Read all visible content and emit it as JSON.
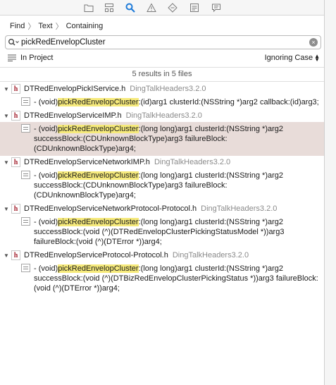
{
  "toolbar": {
    "icons": [
      "folder-icon",
      "hierarchy-icon",
      "search-icon",
      "warning-icon",
      "diamond-icon",
      "list-icon",
      "comment-icon"
    ]
  },
  "find_bar": {
    "mode": "Find",
    "kind": "Text",
    "match": "Containing"
  },
  "search": {
    "value": "pickRedEnvelopCluster",
    "placeholder": ""
  },
  "scope": {
    "label": "In Project",
    "case": "Ignoring Case"
  },
  "summary": "5 results in 5 files",
  "results": [
    {
      "file": "DTRedEnvelopPickIService.h",
      "project": "DingTalkHeaders3.2.0",
      "match": {
        "before": "- (void)",
        "term": "pickRedEnvelopCluster",
        "after": ":(id)arg1 clusterId:(NSString *)arg2 callback:(id)arg3;"
      },
      "selected": false
    },
    {
      "file": "DTRedEnvelopServiceIMP.h",
      "project": "DingTalkHeaders3.2.0",
      "match": {
        "before": "- (void)",
        "term": "pickRedEnvelopCluster",
        "after": ":(long long)arg1 clusterId:(NSString *)arg2 successBlock:(CDUnknownBlockType)arg3 failureBlock:(CDUnknownBlockType)arg4;"
      },
      "selected": true
    },
    {
      "file": "DTRedEnvelopServiceNetworkIMP.h",
      "project": "DingTalkHeaders3.2.0",
      "match": {
        "before": "- (void)",
        "term": "pickRedEnvelopCluster",
        "after": ":(long long)arg1 clusterId:(NSString *)arg2 successBlock:(CDUnknownBlockType)arg3 failureBlock:(CDUnknownBlockType)arg4;"
      },
      "selected": false
    },
    {
      "file": "DTRedEnvelopServiceNetworkProtocol-Protocol.h",
      "project": "DingTalkHeaders3.2.0",
      "match": {
        "before": "- (void)",
        "term": "pickRedEnvelopCluster",
        "after": ":(long long)arg1 clusterId:(NSString *)arg2 successBlock:(void (^)(DTRedEnvelopClusterPickingStatusModel *))arg3 failureBlock:(void (^)(DTError *))arg4;"
      },
      "selected": false
    },
    {
      "file": "DTRedEnvelopServiceProtocol-Protocol.h",
      "project": "DingTalkHeaders3.2.0",
      "match": {
        "before": "- (void)",
        "term": "pickRedEnvelopCluster",
        "after": ":(long long)arg1 clusterId:(NSString *)arg2 successBlock:(void (^)(DTBizRedEnvelopClusterPickingStatus *))arg3 failureBlock:(void (^)(DTError *))arg4;"
      },
      "selected": false
    }
  ],
  "colors": {
    "highlight": "#f6ea7c",
    "selected_row": "#e8dcd9",
    "search_active": "#1f7bd8",
    "header_icon": "#a3222f"
  }
}
